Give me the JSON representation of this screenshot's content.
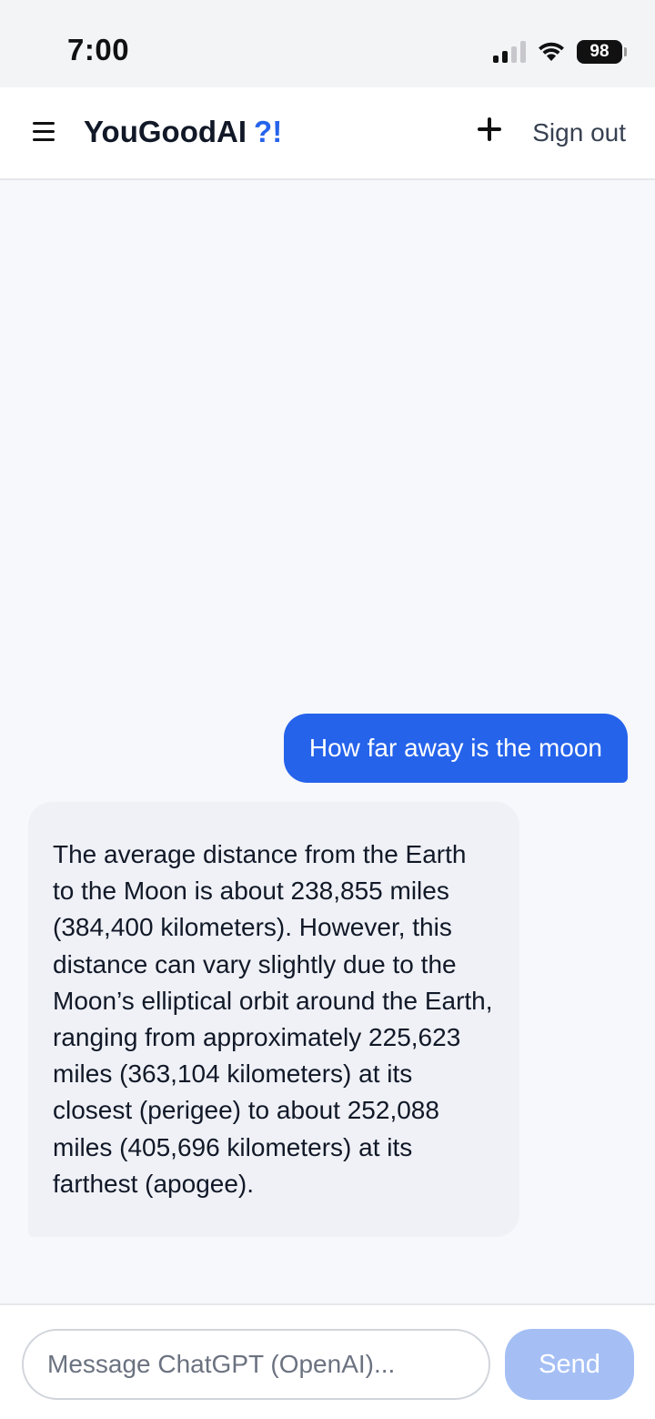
{
  "status_bar": {
    "time": "7:00",
    "battery": "98",
    "signal_icon": "signal-icon",
    "wifi_icon": "wifi-icon"
  },
  "header": {
    "brand": "YouGoodAI",
    "brand_accent": "?!",
    "accent_color": "#2563eb",
    "menu_icon": "hamburger-icon",
    "new_chat_icon": "plus-icon",
    "sign_out_label": "Sign out"
  },
  "messages": [
    {
      "role": "user",
      "text": "How far away is the moon"
    },
    {
      "role": "assistant",
      "text": "The average distance from the Earth to the Moon is about 238,855 miles (384,400 kilometers). However, this distance can vary slightly due to the Moon’s elliptical orbit around the Earth, ranging from approximately 225,623 miles (363,104 kilometers) at its closest (perigee) to about 252,088 miles (405,696 kilometers) at its farthest (apogee)."
    }
  ],
  "composer": {
    "placeholder": "Message ChatGPT (OpenAI)...",
    "send_label": "Send"
  }
}
